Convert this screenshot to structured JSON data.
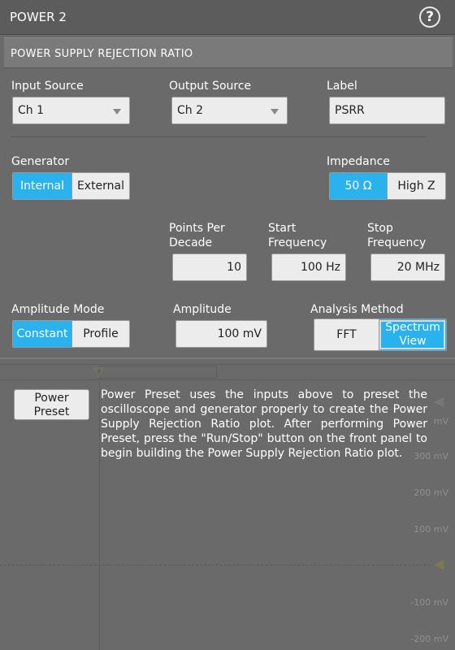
{
  "window": {
    "title": "POWER 2",
    "help_icon": "question-circle-icon"
  },
  "section": {
    "title": "POWER SUPPLY REJECTION RATIO"
  },
  "input_source": {
    "label": "Input Source",
    "value": "Ch 1"
  },
  "output_source": {
    "label": "Output Source",
    "value": "Ch 2"
  },
  "label_field": {
    "label": "Label",
    "value": "PSRR"
  },
  "generator": {
    "label": "Generator",
    "options": [
      "Internal",
      "External"
    ],
    "selected": "Internal"
  },
  "impedance": {
    "label": "Impedance",
    "options": [
      "50 Ω",
      "High Z"
    ],
    "selected": "50 Ω"
  },
  "points_per_decade": {
    "label_line1": "Points Per",
    "label_line2": "Decade",
    "value": "10"
  },
  "start_frequency": {
    "label_line1": "Start",
    "label_line2": "Frequency",
    "value": "100 Hz"
  },
  "stop_frequency": {
    "label_line1": "Stop",
    "label_line2": "Frequency",
    "value": "20 MHz"
  },
  "amplitude_mode": {
    "label": "Amplitude Mode",
    "options": [
      "Constant",
      "Profile"
    ],
    "selected": "Constant"
  },
  "amplitude": {
    "label": "Amplitude",
    "value": "100 mV"
  },
  "analysis_method": {
    "label": "Analysis Method",
    "options": [
      "FFT",
      "Spectrum View"
    ],
    "option2_line1": "Spectrum",
    "option2_line2": "View",
    "selected": "Spectrum View"
  },
  "power_preset": {
    "button_line1": "Power",
    "button_line2": "Preset",
    "description": "Power Preset uses the inputs above to preset the oscilloscope and generator properly to create the Power Supply Rejection Ratio plot. After performing Power Preset, press the \"Run/Stop\" button on the front panel to begin building the Power Supply Rejection Ratio plot."
  },
  "scope_scale": {
    "labels": [
      "mV",
      "300 mV",
      "200 mV",
      "100 mV",
      "-100 mV",
      "-200 mV"
    ]
  }
}
